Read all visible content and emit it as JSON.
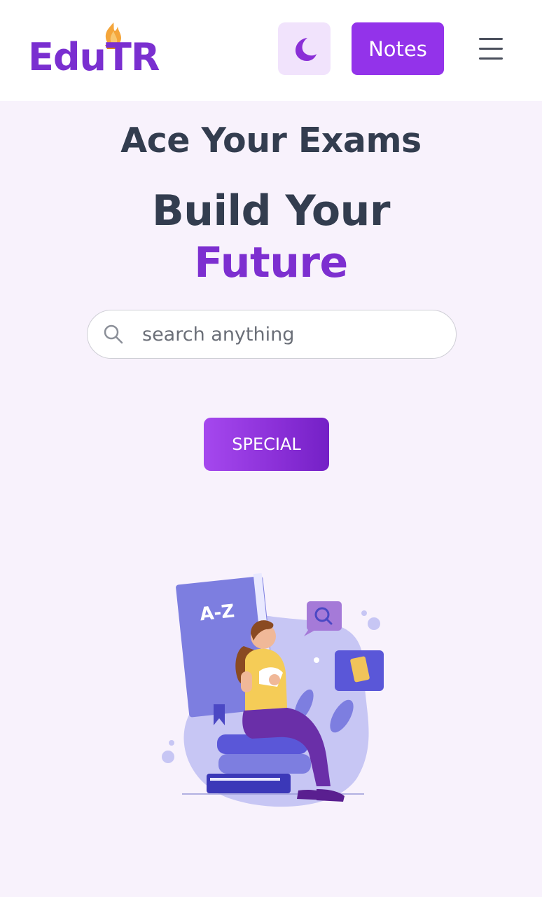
{
  "header": {
    "logo_text": "EduTR",
    "theme_toggle_icon": "moon-icon",
    "notes_label": "Notes",
    "menu_icon": "hamburger-menu-icon"
  },
  "hero": {
    "tagline": "Ace Your Exams",
    "headline_line1": "Build Your",
    "headline_line2": "Future"
  },
  "search": {
    "icon": "search-icon",
    "placeholder": "search anything",
    "value": ""
  },
  "special_label": "SPECIAL",
  "illustration": {
    "book_cover_text": "A-Z"
  },
  "colors": {
    "brand_purple": "#9333ea",
    "headline_dark": "#333d4f",
    "future_purple": "#7d2fd0",
    "background": "#f8f2fc",
    "moon_button_bg": "#f1e3fc"
  }
}
